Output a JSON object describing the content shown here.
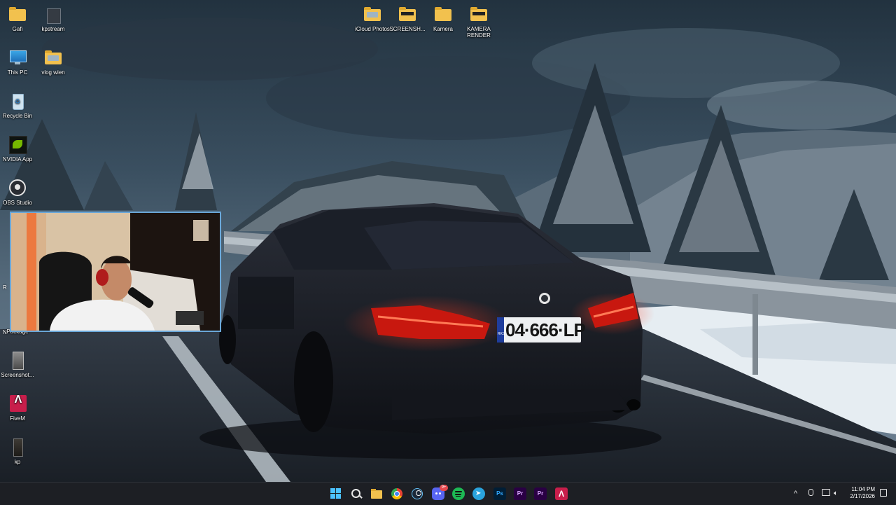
{
  "desktop": {
    "icons": [
      {
        "label": "Gafi",
        "icon": "folder-icon"
      },
      {
        "label": "kpstream",
        "icon": "file-icon"
      },
      {
        "label": "This PC",
        "icon": "this-pc-icon"
      },
      {
        "label": "vlog wien",
        "icon": "folder-icon"
      },
      {
        "label": "Recycle Bin",
        "icon": "recycle-bin-icon"
      },
      {
        "label": "NVIDIA App",
        "icon": "nvidia-icon"
      },
      {
        "label": "OBS Studio",
        "icon": "obs-icon"
      },
      {
        "label": "Package",
        "icon": "package-icon"
      },
      {
        "label": "Screenshot...",
        "icon": "image-file-icon"
      },
      {
        "label": "FiveM",
        "icon": "fivem-icon"
      },
      {
        "label": "kp",
        "icon": "image-file-icon"
      },
      {
        "label": "iCloud Photos",
        "icon": "folder-icon"
      },
      {
        "label": "SCREENSH...",
        "icon": "folder-icon"
      },
      {
        "label": "Kamera",
        "icon": "folder-icon"
      },
      {
        "label": "KAMERA RENDER",
        "icon": "folder-icon"
      }
    ],
    "partial_labels": {
      "left_r": "R",
      "left_n": "N"
    },
    "wallpaper": {
      "plate": "04·666·LP",
      "plate_country": "RKS"
    }
  },
  "taskbar": {
    "apps": [
      {
        "name": "Start",
        "icon": "windows-start-icon"
      },
      {
        "name": "Search",
        "icon": "search-icon"
      },
      {
        "name": "File Explorer",
        "icon": "folder-icon"
      },
      {
        "name": "Chrome",
        "icon": "chrome-icon"
      },
      {
        "name": "Steam",
        "icon": "steam-icon"
      },
      {
        "name": "Discord",
        "icon": "discord-icon",
        "badge": "9+"
      },
      {
        "name": "Spotify",
        "icon": "spotify-icon"
      },
      {
        "name": "Telegram",
        "icon": "telegram-icon"
      },
      {
        "name": "Ps",
        "icon": "photoshop-icon"
      },
      {
        "name": "Pr",
        "icon": "premiere-icon"
      },
      {
        "name": "Pr",
        "icon": "premiere-icon"
      },
      {
        "name": "FiveM",
        "icon": "fivem-icon"
      }
    ],
    "tray": {
      "chevron": "^"
    },
    "clock": {
      "time": "11:04 PM",
      "date": "2/17/2026"
    }
  },
  "colors": {
    "taskbar_bg": "#1d1f24",
    "webcam_border": "#6aa7d8",
    "taillight": "#ff2a1a",
    "discord": "#5865f2",
    "spotify": "#1db954",
    "telegram": "#2aa3dd",
    "photoshop": "#001e36",
    "premiere": "#2a0044",
    "fivem": "#c81e4b"
  }
}
